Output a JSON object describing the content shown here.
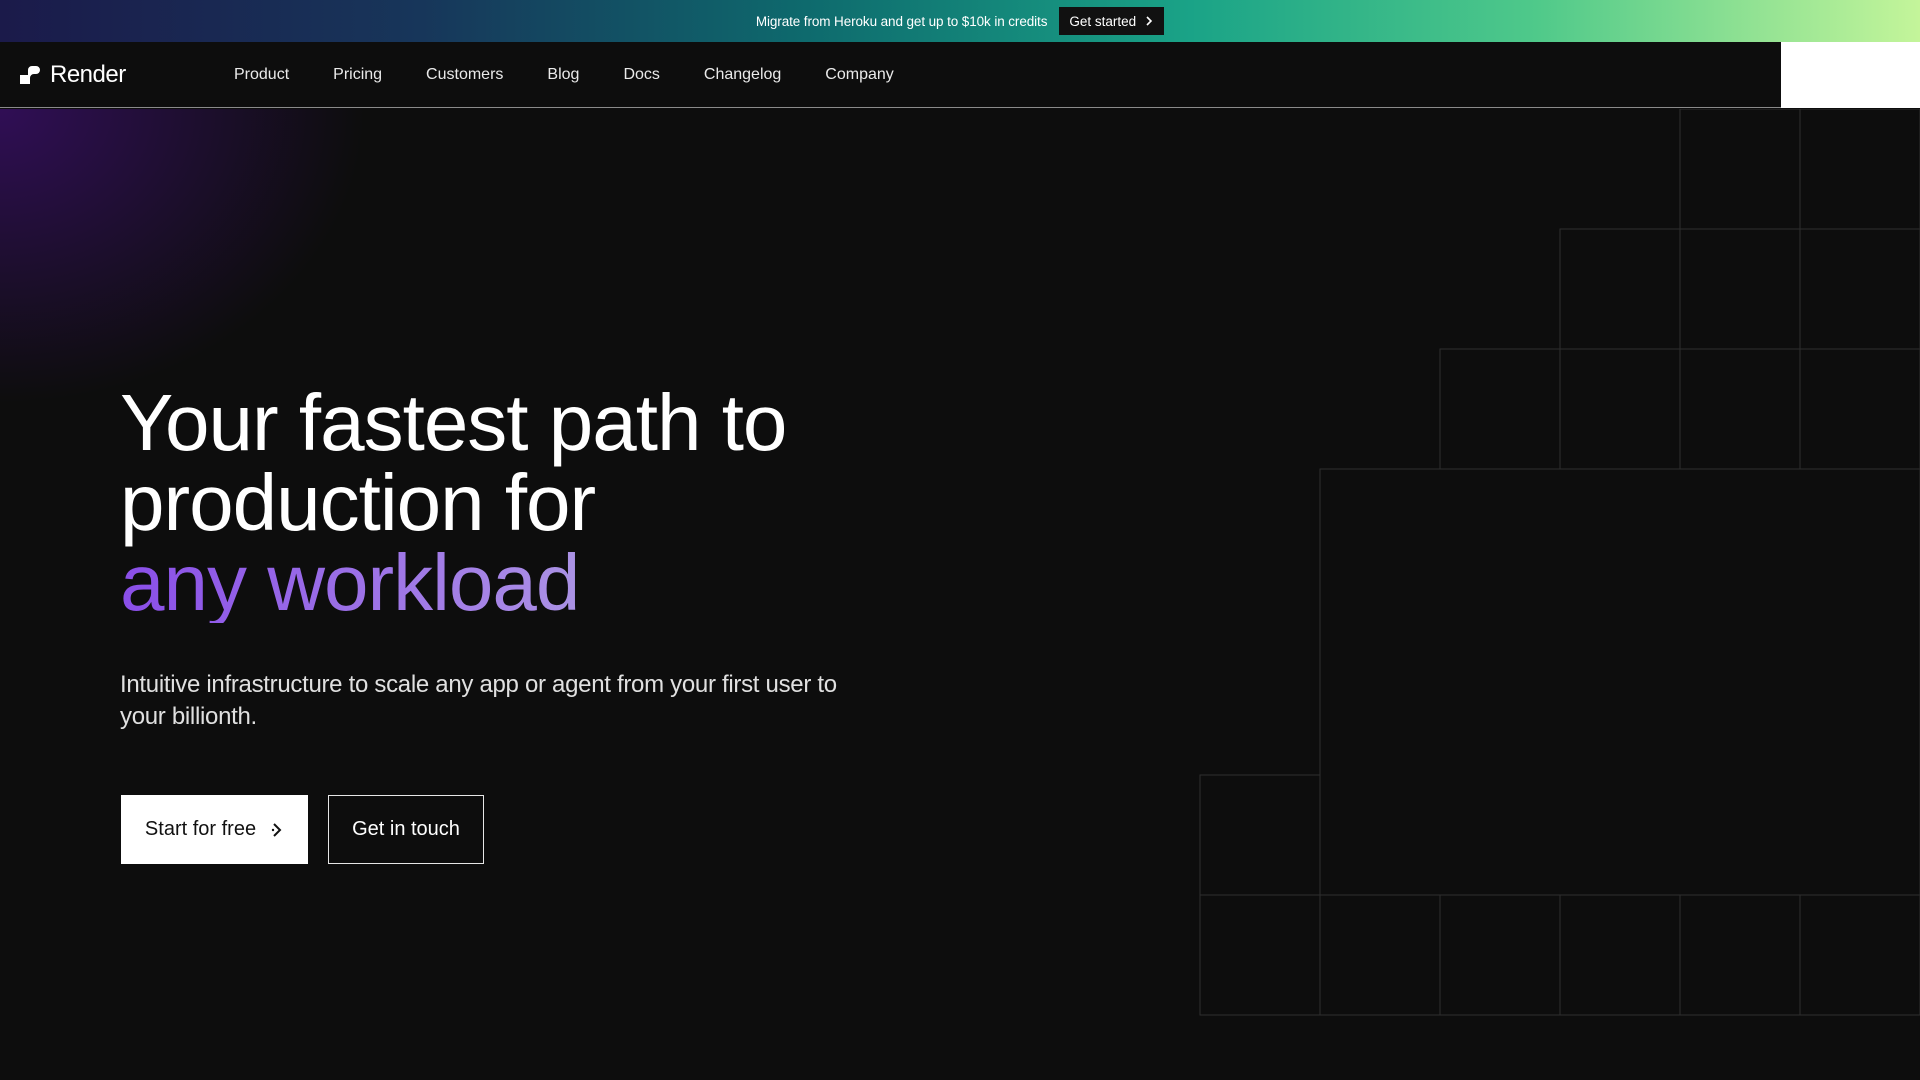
{
  "banner": {
    "text": "Migrate from Heroku and get up to $10k in credits",
    "cta_label": "Get started",
    "cta_icon": "chevron-right-icon"
  },
  "nav": {
    "logo_text": "Render",
    "logo_icon": "render-logo-icon",
    "links": [
      "Product",
      "Pricing",
      "Customers",
      "Blog",
      "Docs",
      "Changelog",
      "Company"
    ]
  },
  "hero": {
    "headline_line1": "Your fastest path to",
    "headline_line2": "production for",
    "headline_accent": "any workload",
    "subhead": "Intuitive infrastructure to scale any app or agent from your first user to your billionth.",
    "primary_cta": "Start for free",
    "primary_cta_icon": "chevron-right-icon",
    "secondary_cta": "Get in touch"
  },
  "colors": {
    "background": "#0d0d0d",
    "accent_purple": "#8a4ee8",
    "accent_mint": "#b8e4cf",
    "banner_start": "#1b1a4a",
    "banner_end": "#c4f59a"
  }
}
